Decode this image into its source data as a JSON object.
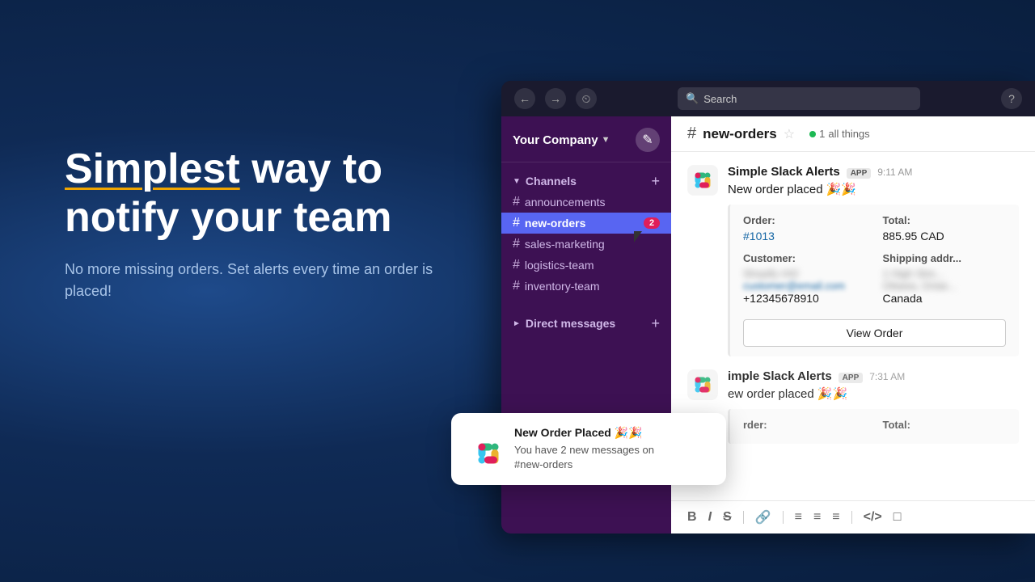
{
  "background": {
    "color": "#1a3a6b"
  },
  "hero": {
    "title_plain": "way to notify your team",
    "title_highlight": "Simplest",
    "subtitle": "No more missing orders. Set alerts every time an order is placed!"
  },
  "topbar": {
    "search_placeholder": "Search",
    "nav_back": "←",
    "nav_forward": "→",
    "clock_icon": "⏱",
    "help_icon": "?"
  },
  "sidebar": {
    "workspace_name": "Your Company",
    "channels_label": "Channels",
    "direct_messages_label": "Direct messages",
    "channels": [
      {
        "name": "announcements",
        "active": false,
        "badge": null
      },
      {
        "name": "new-orders",
        "active": true,
        "badge": "2"
      },
      {
        "name": "sales-marketing",
        "active": false,
        "badge": null
      },
      {
        "name": "logistics-team",
        "active": false,
        "badge": null
      },
      {
        "name": "inventory-team",
        "active": false,
        "badge": null
      }
    ]
  },
  "chat": {
    "channel_name": "new-orders",
    "members_count": "1",
    "members_label": "all things",
    "messages": [
      {
        "sender": "Simple Slack Alerts",
        "app_badge": "APP",
        "time": "9:11 AM",
        "text": "New order placed 🎉🎉",
        "order": {
          "order_label": "Order:",
          "order_value": "#1013",
          "total_label": "Total:",
          "total_value": "885.95 CAD",
          "customer_label": "Customer:",
          "customer_name_blurred": "Shopify #42",
          "customer_email_blurred": "customer@email.com",
          "customer_phone": "+12345678910",
          "shipping_label": "Shipping addr...",
          "shipping_value_blurred": "1 High Stre...",
          "shipping_city_blurred": "Ottawa, Ontar...",
          "shipping_country": "Canada",
          "view_order_btn": "View Order"
        }
      },
      {
        "sender": "imple Slack Alerts",
        "app_badge": "APP",
        "time": "7:31 AM",
        "text": "ew order placed 🎉🎉",
        "order_partial": {
          "order_label": "rder:",
          "total_label": "Total:"
        }
      }
    ]
  },
  "compose": {
    "tools": [
      "B",
      "I",
      "S",
      "🔗",
      "≡",
      "≡",
      "≡",
      "</>",
      "□"
    ]
  },
  "notification": {
    "title": "New Order Placed 🎉🎉",
    "body_line1": "You have 2 new messages on",
    "body_line2": "#new-orders"
  }
}
